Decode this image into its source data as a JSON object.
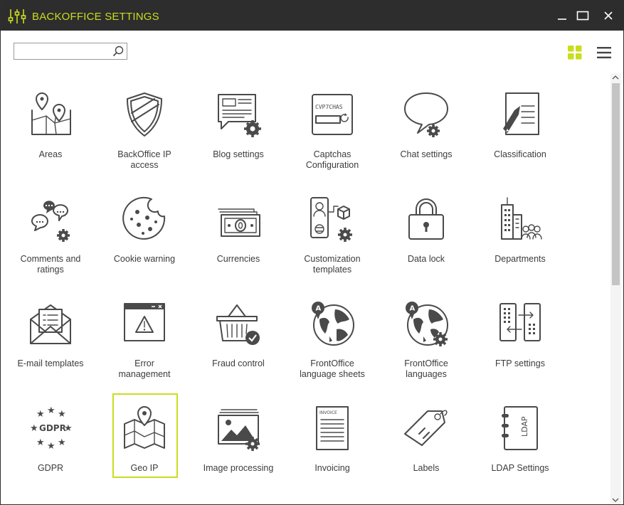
{
  "window": {
    "title": "BACKOFFICE SETTINGS"
  },
  "toolbar": {
    "search_value": "",
    "search_placeholder": ""
  },
  "items": [
    {
      "label": "Areas",
      "icon": "map-pins-icon"
    },
    {
      "label": "BackOffice IP\naccess",
      "icon": "shield-icon"
    },
    {
      "label": "Blog settings",
      "icon": "blog-settings-icon"
    },
    {
      "label": "Captchas\nConfiguration",
      "icon": "captcha-icon"
    },
    {
      "label": "Chat settings",
      "icon": "chat-settings-icon"
    },
    {
      "label": "Classification",
      "icon": "classification-icon"
    },
    {
      "label": "Comments and\nratings",
      "icon": "comments-icon"
    },
    {
      "label": "Cookie warning",
      "icon": "cookie-icon"
    },
    {
      "label": "Currencies",
      "icon": "banknotes-icon"
    },
    {
      "label": "Customization\ntemplates",
      "icon": "customization-icon"
    },
    {
      "label": "Data lock",
      "icon": "padlock-icon"
    },
    {
      "label": "Departments",
      "icon": "buildings-icon"
    },
    {
      "label": "E-mail templates",
      "icon": "email-icon"
    },
    {
      "label": "Error\nmanagement",
      "icon": "error-window-icon"
    },
    {
      "label": "Fraud control",
      "icon": "basket-check-icon"
    },
    {
      "label": "FrontOffice\nlanguage sheets",
      "icon": "globe-language-icon"
    },
    {
      "label": "FrontOffice\nlanguages",
      "icon": "globe-settings-icon"
    },
    {
      "label": "FTP settings",
      "icon": "ftp-transfer-icon"
    },
    {
      "label": "GDPR",
      "icon": "gdpr-stars-icon"
    },
    {
      "label": "Geo IP",
      "icon": "geo-map-icon",
      "selected": true
    },
    {
      "label": "Image processing",
      "icon": "image-settings-icon"
    },
    {
      "label": "Invoicing",
      "icon": "invoice-icon"
    },
    {
      "label": "Labels",
      "icon": "tag-icon"
    },
    {
      "label": "LDAP Settings",
      "icon": "ldap-book-icon"
    }
  ],
  "icon_text": {
    "captcha": "CVP7CHAS",
    "invoice": "INVOICE",
    "gdpr": "GDPR",
    "ldap": "LDAP",
    "lang": "A"
  },
  "colors": {
    "titlebar": "#2d2d2d",
    "accent": "#c9dd1f",
    "icon": "#4a4a4a",
    "background": "#ffffff"
  }
}
